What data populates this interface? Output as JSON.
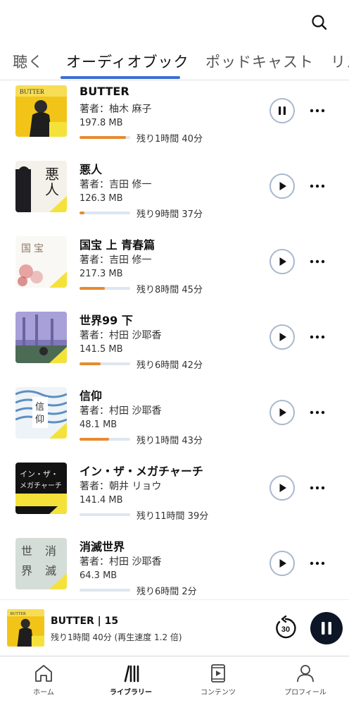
{
  "tabs": [
    {
      "label": "聴く"
    },
    {
      "label": "オーディオブック",
      "active": true
    },
    {
      "label": "ポッドキャスト"
    },
    {
      "label": "リス"
    }
  ],
  "books": [
    {
      "title": "BUTTER",
      "author": "著者：柚木 麻子",
      "size": "197.8 MB",
      "remaining": "残り1時間 40分",
      "progress": 0.92,
      "state": "playing",
      "cover": "butter"
    },
    {
      "title": "悪人",
      "author": "著者：吉田 修一",
      "size": "126.3 MB",
      "remaining": "残り9時間 37分",
      "progress": 0.1,
      "state": "paused",
      "cover": "akunin"
    },
    {
      "title": "国宝 上 青春篇",
      "author": "著者：吉田 修一",
      "size": "217.3 MB",
      "remaining": "残り8時間 45分",
      "progress": 0.5,
      "state": "paused",
      "cover": "kokuho"
    },
    {
      "title": "世界99 下",
      "author": "著者：村田 沙耶香",
      "size": "141.5 MB",
      "remaining": "残り6時間 42分",
      "progress": 0.42,
      "state": "paused",
      "cover": "sekai"
    },
    {
      "title": "信仰",
      "author": "著者：村田 沙耶香",
      "size": "48.1 MB",
      "remaining": "残り1時間 43分",
      "progress": 0.58,
      "state": "paused",
      "cover": "shinko"
    },
    {
      "title": "イン・ザ・メガチャーチ",
      "author": "著者：朝井 リョウ",
      "size": "141.4 MB",
      "remaining": "残り11時間 39分",
      "progress": 0.0,
      "state": "paused",
      "cover": "mega"
    },
    {
      "title": "消滅世界",
      "author": "著者：村田 沙耶香",
      "size": "64.3 MB",
      "remaining": "残り6時間 2分",
      "progress": 0.0,
      "state": "paused",
      "cover": "shometsu"
    }
  ],
  "mini_player": {
    "title": "BUTTER | 15",
    "subtitle": "残り1時間 40分 (再生速度 1.2 倍)",
    "skip_seconds": "30"
  },
  "nav": [
    {
      "label": "ホーム",
      "icon": "home-icon"
    },
    {
      "label": "ライブラリー",
      "icon": "library-icon",
      "active": true
    },
    {
      "label": "コンテンツ",
      "icon": "content-icon"
    },
    {
      "label": "プロフィール",
      "icon": "profile-icon"
    }
  ],
  "colors": {
    "accent": "#3b6fd0",
    "progress": "#e88a2e",
    "progress_track": "#dde6f1",
    "play_button_border": "#a9b8cc",
    "mini_pause_bg": "#0d1626"
  }
}
